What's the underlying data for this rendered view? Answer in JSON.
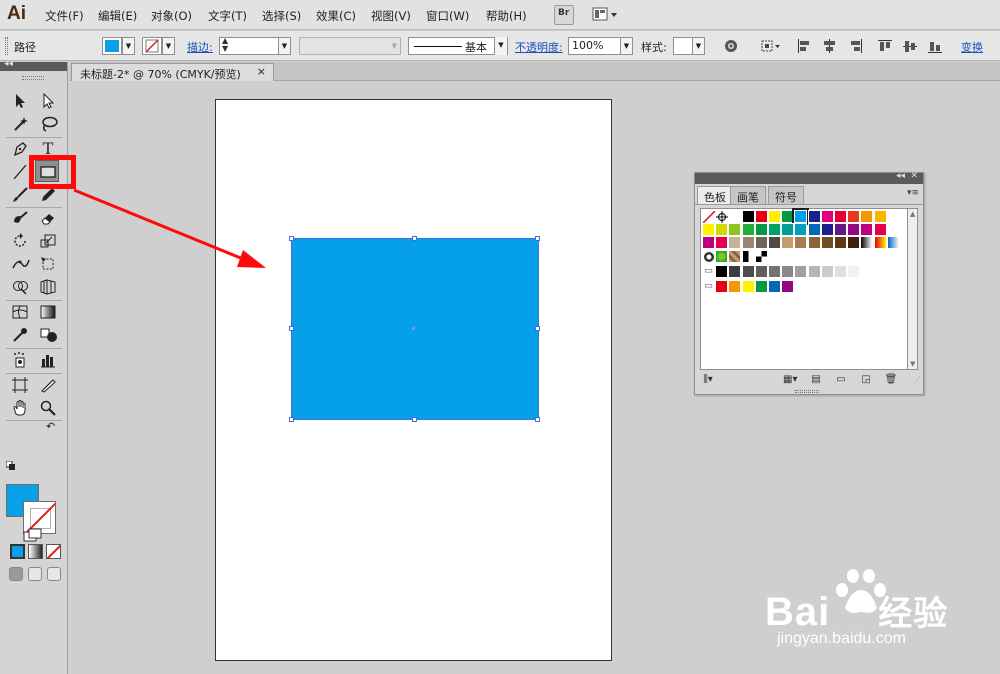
{
  "app": {
    "logo": "Ai"
  },
  "menu": {
    "items": [
      "文件(F)",
      "编辑(E)",
      "对象(O)",
      "文字(T)",
      "选择(S)",
      "效果(C)",
      "视图(V)",
      "窗口(W)",
      "帮助(H)"
    ],
    "bridge_label": "Br"
  },
  "controlbar": {
    "selection_label": "路径",
    "stroke_label": "描边:",
    "brush_label": "基本",
    "opacity_label": "不透明度:",
    "opacity_value": "100%",
    "style_label": "样式:",
    "transform_label": "变换"
  },
  "document": {
    "tab_title": "未标题-2* @ 70% (CMYK/预览)",
    "close_symbol": "×"
  },
  "tools": {
    "type_tool_glyph": "T"
  },
  "colors": {
    "fill": "#08a0e9",
    "shape_fill": "#06a0ea",
    "annotation": "#ff0a0a"
  },
  "swatches_panel": {
    "tabs": [
      "色板",
      "画笔",
      "符号"
    ],
    "rows": [
      [
        "#ffffff",
        "#000000",
        "#e60012",
        "#fff100",
        "#009944",
        "#00a0e9",
        "#1d2088",
        "#e4007f",
        "#e60033",
        "#e83820",
        "#f39800",
        "#f8b500"
      ],
      [
        "#fff100",
        "#cfdb00",
        "#8fc31f",
        "#22ac38",
        "#009944",
        "#00a06b",
        "#009e96",
        "#00a0c1",
        "#0068b7",
        "#1d2088",
        "#601986",
        "#920783"
      ],
      [
        "#be0081",
        "#e5004f",
        "#c7b299",
        "#998675",
        "#736357",
        "#534741",
        "#c69c6d",
        "#a67c52",
        "#8c6239",
        "#754c24",
        "#603813",
        "#42210b"
      ],
      [
        "#f2f2f2",
        "#3c3c3c",
        "#4d4d4d",
        "#5f5f5f",
        "#737373",
        "#898989",
        "#9f9f9f",
        "#b5b5b5",
        "#cccccc",
        "#e0e0e0",
        "#f2f2f2"
      ],
      [
        "#e60012",
        "#f39800",
        "#fff100",
        "#009944",
        "#0068b7",
        "#920783"
      ]
    ]
  },
  "watermark": {
    "brand": "Bai",
    "brand_cn": "经验",
    "url": "jingyan.baidu.com"
  }
}
